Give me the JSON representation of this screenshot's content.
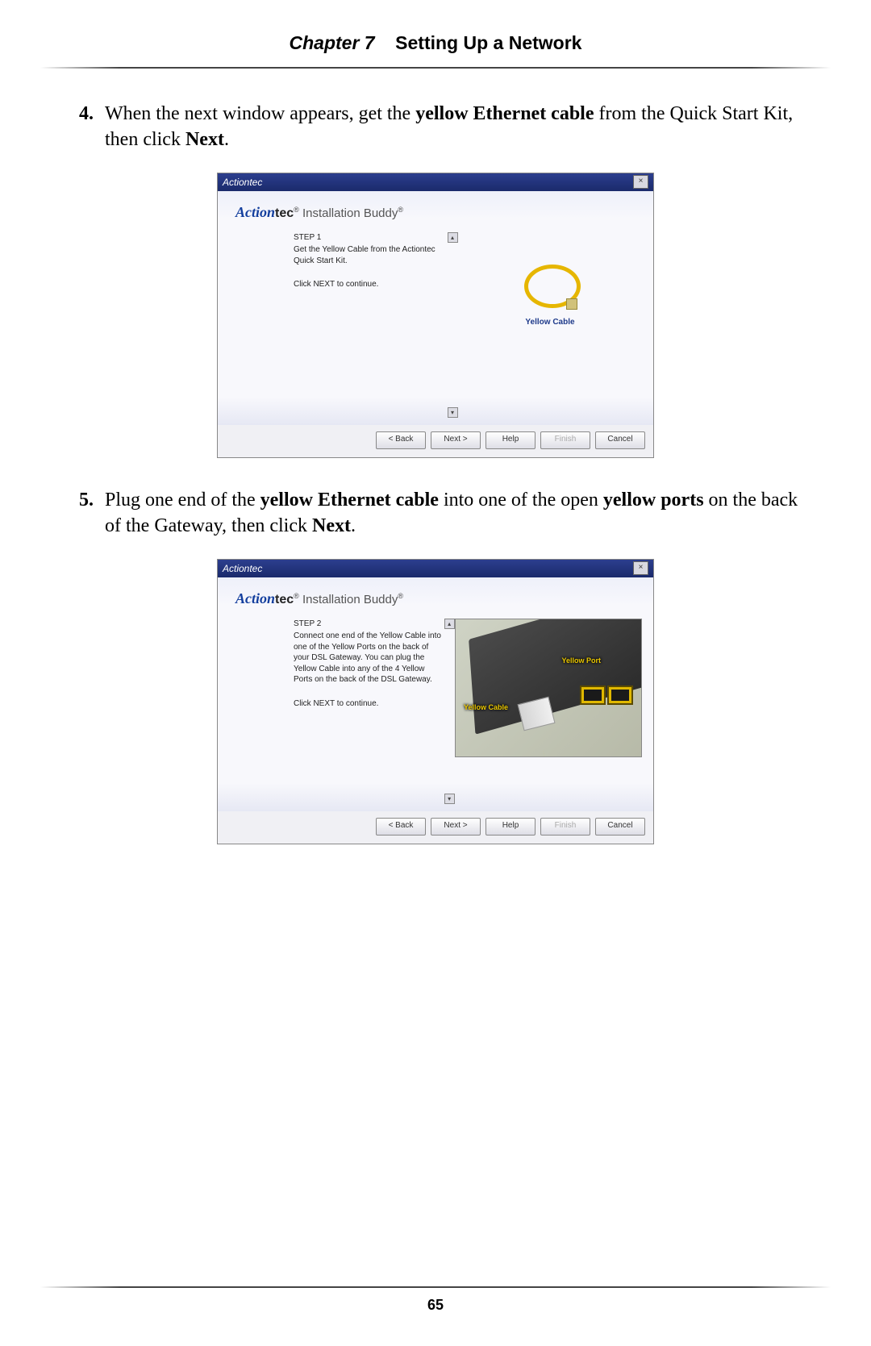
{
  "header": {
    "chapter": "Chapter 7",
    "title": "Setting Up a Network"
  },
  "steps": [
    {
      "num": "4.",
      "pre": "When the next window appears, get the ",
      "b1": "yellow Ethernet cable",
      "mid": " from the Quick Start Kit, then click ",
      "b2": "Next",
      "post": "."
    },
    {
      "num": "5.",
      "pre": "Plug one end of the ",
      "b1": "yellow Ethernet cable",
      "mid": " into one of the open ",
      "b2": "yellow ports",
      "post2": " on the back of the Gateway, then click ",
      "b3": "Next",
      "end": "."
    }
  ],
  "wizard": {
    "titlebar_brand": "Actiontec",
    "close": "×",
    "logo_a": "Action",
    "logo_tec": "tec",
    "reg": "®",
    "install_buddy": " Installation Buddy",
    "scroll_up": "▴",
    "scroll_down": "▾",
    "buttons": {
      "back": "< Back",
      "next": "Next >",
      "help": "Help",
      "finish": "Finish",
      "cancel": "Cancel"
    }
  },
  "w1": {
    "step": "STEP 1",
    "line1": "Get the Yellow Cable from the Actiontec Quick Start Kit.",
    "line2": "Click NEXT to continue.",
    "caption": "Yellow Cable"
  },
  "w2": {
    "step": "STEP 2",
    "line1": "Connect one end of the Yellow Cable into one of the Yellow Ports on the back of your DSL Gateway.  You can plug the Yellow Cable into any of the 4 Yellow Ports on the back of the DSL Gateway.",
    "line2": "Click NEXT to continue.",
    "label_port": "Yellow Port",
    "label_cable": "Yellow Cable"
  },
  "page_number": "65"
}
